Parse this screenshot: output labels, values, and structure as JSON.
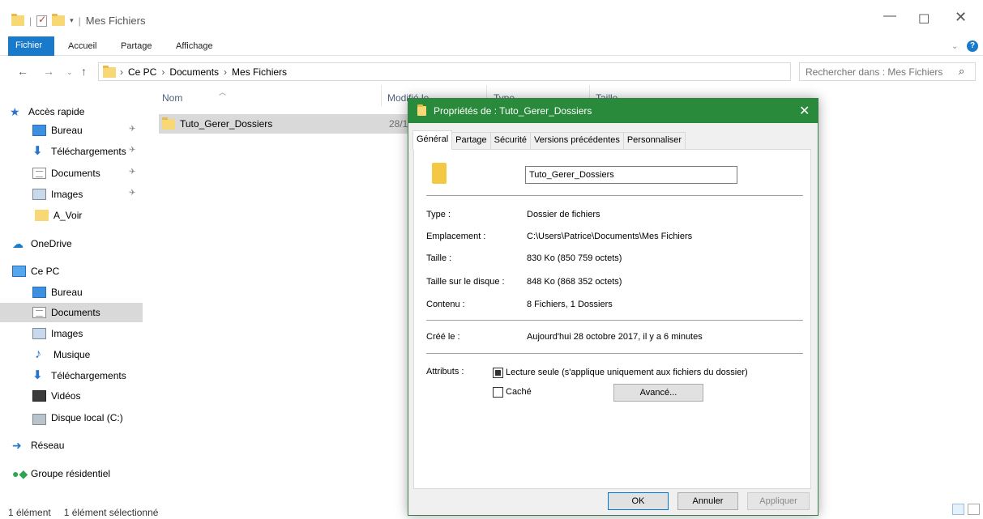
{
  "window": {
    "title": "Mes Fichiers",
    "minimize": "—",
    "maximize": "☐",
    "close": "✕"
  },
  "ribbon": {
    "tabs": [
      "Fichier",
      "Accueil",
      "Partage",
      "Affichage"
    ],
    "help": "?",
    "expand": "⌄"
  },
  "address": {
    "back": "←",
    "forward": "→",
    "recent": "⌄",
    "up": "↑",
    "crumbs": [
      "Ce PC",
      "Documents",
      "Mes Fichiers"
    ],
    "crumb_sep": "›",
    "dropdown": "⌄",
    "refresh": "↻",
    "search_placeholder": "Rechercher dans : Mes Fichiers",
    "search_icon": "⌕"
  },
  "nav": {
    "quick_access": "Accès rapide",
    "quick_items": [
      "Bureau",
      "Téléchargements",
      "Documents",
      "Images",
      "A_Voir"
    ],
    "onedrive": "OneDrive",
    "this_pc": "Ce PC",
    "pc_items": [
      "Bureau",
      "Documents",
      "Images",
      "Musique",
      "Téléchargements",
      "Vidéos",
      "Disque local (C:)"
    ],
    "network": "Réseau",
    "homegroup": "Groupe résidentiel",
    "selected": "Documents"
  },
  "files": {
    "columns": [
      "Nom",
      "Modifié le",
      "Type",
      "Taille"
    ],
    "rows": [
      {
        "name": "Tuto_Gerer_Dossiers",
        "modified": "28/1"
      }
    ]
  },
  "status": {
    "count": "1 élément",
    "selected": "1 élément sélectionné"
  },
  "dialog": {
    "title": "Propriétés de : Tuto_Gerer_Dossiers",
    "close": "✕",
    "tabs": [
      "Général",
      "Partage",
      "Sécurité",
      "Versions précédentes",
      "Personnaliser"
    ],
    "active_tab": "Général",
    "folder_name": "Tuto_Gerer_Dossiers",
    "props": {
      "type_label": "Type :",
      "type_value": "Dossier de fichiers",
      "location_label": "Emplacement :",
      "location_value": "C:\\Users\\Patrice\\Documents\\Mes Fichiers",
      "size_label": "Taille :",
      "size_value": "830 Ko (850 759 octets)",
      "disk_size_label": "Taille sur le disque :",
      "disk_size_value": "848 Ko (868 352 octets)",
      "contents_label": "Contenu :",
      "contents_value": "8 Fichiers, 1 Dossiers",
      "created_label": "Créé le :",
      "created_value": "Aujourd'hui 28 octobre 2017, il y a 6 minutes",
      "attributes_label": "Attributs :",
      "readonly_label": "Lecture seule (s'applique uniquement aux fichiers du dossier)",
      "hidden_label": "Caché",
      "advanced_button": "Avancé..."
    },
    "buttons": {
      "ok": "OK",
      "cancel": "Annuler",
      "apply": "Appliquer"
    }
  }
}
